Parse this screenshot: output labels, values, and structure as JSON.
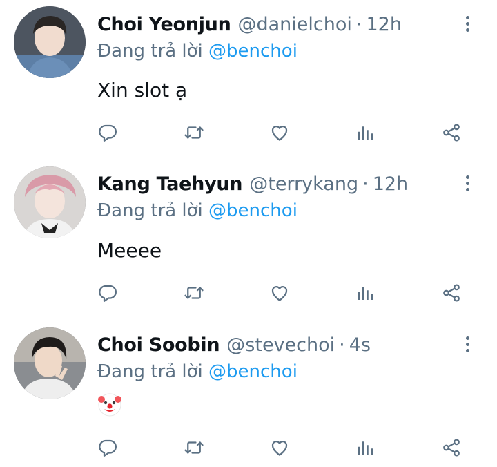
{
  "replies": [
    {
      "name": "Choi Yeonjun",
      "handle": "@danielchoi",
      "separator": "·",
      "time": "12h",
      "reply_prefix": "Đang trả lời",
      "reply_to": "@benchoi",
      "text": "Xin slot ạ"
    },
    {
      "name": "Kang Taehyun",
      "handle": "@terrykang",
      "separator": "·",
      "time": "12h",
      "reply_prefix": "Đang trả lời",
      "reply_to": "@benchoi",
      "text": "Meeee"
    },
    {
      "name": "Choi Soobin",
      "handle": "@stevechoi",
      "separator": "·",
      "time": "4s",
      "reply_prefix": "Đang trả lời",
      "reply_to": "@benchoi",
      "text": "",
      "emoji": "clown-face-icon"
    }
  ],
  "icons": {
    "reply": "comment-icon",
    "retweet": "retweet-icon",
    "like": "heart-icon",
    "analytics": "analytics-icon",
    "share": "share-icon",
    "more": "more-vertical-icon"
  },
  "colors": {
    "text": "#0f1419",
    "secondary": "#5b7083",
    "link": "#1d9bf0",
    "divider": "#e1e4e8"
  }
}
